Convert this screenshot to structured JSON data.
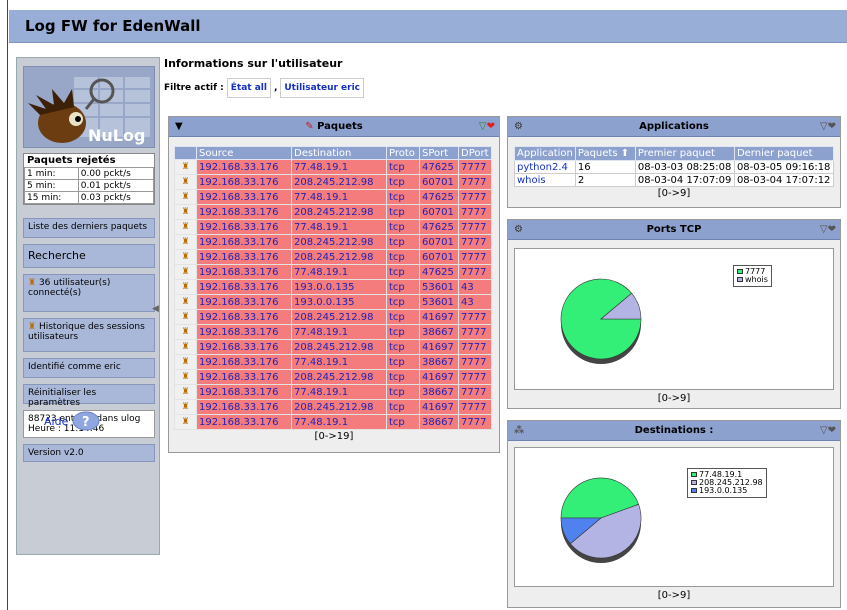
{
  "header": {
    "title": "Log FW for EdenWall"
  },
  "logo": {
    "text": "NuLog"
  },
  "sidebar": {
    "stats_title": "Paquets rejetés",
    "stats": [
      {
        "label": "1 min:",
        "value": "0.00 pckt/s"
      },
      {
        "label": "5 min:",
        "value": "0.01 pckt/s"
      },
      {
        "label": "15 min:",
        "value": "0.03 pckt/s"
      }
    ],
    "last_packets": "Liste des derniers paquets",
    "search": "Recherche",
    "users_connected": "36 utilisateur(s) connecté(s)",
    "history": "Historique des sessions utilisateurs",
    "identified": "Identifié comme eric",
    "reset": "Réinitialiser les paramètres",
    "entries": "88723 entrées dans ulog",
    "hour": "Heure : 11:14:46",
    "version": "Version v2.0",
    "help": "Aide"
  },
  "main": {
    "title": "Informations sur l'utilisateur",
    "filter_label": "Filtre actif :",
    "filter_state": "État all",
    "filter_sep": ",",
    "filter_user": "Utilisateur eric"
  },
  "packets": {
    "title": "Paquets",
    "columns": [
      "Source",
      "Destination",
      "Proto",
      "SPort",
      "DPort"
    ],
    "rows": [
      [
        "192.168.33.176",
        "77.48.19.1",
        "tcp",
        "47625",
        "7777"
      ],
      [
        "192.168.33.176",
        "208.245.212.98",
        "tcp",
        "60701",
        "7777"
      ],
      [
        "192.168.33.176",
        "77.48.19.1",
        "tcp",
        "47625",
        "7777"
      ],
      [
        "192.168.33.176",
        "208.245.212.98",
        "tcp",
        "60701",
        "7777"
      ],
      [
        "192.168.33.176",
        "77.48.19.1",
        "tcp",
        "47625",
        "7777"
      ],
      [
        "192.168.33.176",
        "208.245.212.98",
        "tcp",
        "60701",
        "7777"
      ],
      [
        "192.168.33.176",
        "208.245.212.98",
        "tcp",
        "60701",
        "7777"
      ],
      [
        "192.168.33.176",
        "77.48.19.1",
        "tcp",
        "47625",
        "7777"
      ],
      [
        "192.168.33.176",
        "193.0.0.135",
        "tcp",
        "53601",
        "43"
      ],
      [
        "192.168.33.176",
        "193.0.0.135",
        "tcp",
        "53601",
        "43"
      ],
      [
        "192.168.33.176",
        "208.245.212.98",
        "tcp",
        "41697",
        "7777"
      ],
      [
        "192.168.33.176",
        "77.48.19.1",
        "tcp",
        "38667",
        "7777"
      ],
      [
        "192.168.33.176",
        "208.245.212.98",
        "tcp",
        "41697",
        "7777"
      ],
      [
        "192.168.33.176",
        "77.48.19.1",
        "tcp",
        "38667",
        "7777"
      ],
      [
        "192.168.33.176",
        "208.245.212.98",
        "tcp",
        "41697",
        "7777"
      ],
      [
        "192.168.33.176",
        "77.48.19.1",
        "tcp",
        "38667",
        "7777"
      ],
      [
        "192.168.33.176",
        "208.245.212.98",
        "tcp",
        "41697",
        "7777"
      ],
      [
        "192.168.33.176",
        "77.48.19.1",
        "tcp",
        "38667",
        "7777"
      ]
    ],
    "pager": "[0->19]"
  },
  "applications": {
    "title": "Applications",
    "columns": [
      "Application",
      "Paquets",
      "Premier paquet",
      "Dernier paquet"
    ],
    "rows": [
      [
        "python2.4",
        "16",
        "08-03-03 08:25:08",
        "08-03-05 09:16:18"
      ],
      [
        "whois",
        "2",
        "08-03-04 17:07:09",
        "08-03-04 17:07:12"
      ]
    ],
    "pager": "[0->9]"
  },
  "tcp_ports": {
    "title": "Ports TCP",
    "pager": "[0->9]"
  },
  "destinations": {
    "title": "Destinations :",
    "pager": "[0->9]"
  },
  "colors": {
    "green": "#33ee77",
    "lavender": "#b4b4e4",
    "blue": "#4f82ee",
    "header": "#99aed7",
    "row_red": "#f47c7c"
  },
  "chart_data": [
    {
      "type": "pie",
      "title": "Ports TCP",
      "categories": [
        "7777",
        "whois"
      ],
      "values": [
        16,
        2
      ],
      "legend": "top-right"
    },
    {
      "type": "pie",
      "title": "Destinations :",
      "categories": [
        "77.48.19.1",
        "208.245.212.98",
        "193.0.0.135"
      ],
      "values": [
        8,
        8,
        2
      ],
      "legend": "top-right"
    }
  ]
}
